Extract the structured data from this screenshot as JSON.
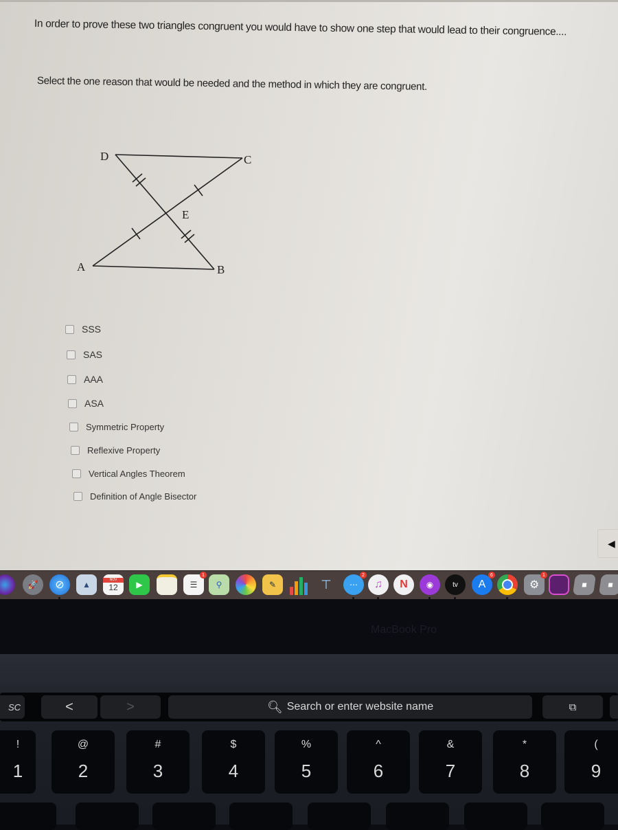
{
  "question": {
    "line1": "In order to prove these two triangles congruent you would have to show one step that would lead to their congruence....",
    "line2": "Select the one reason that would be needed and the method in which they are congruent."
  },
  "figure": {
    "labels": {
      "D": "D",
      "C": "C",
      "E": "E",
      "A": "A",
      "B": "B"
    }
  },
  "options": [
    {
      "label": "SSS",
      "checked": false
    },
    {
      "label": "SAS",
      "checked": false
    },
    {
      "label": "AAA",
      "checked": false
    },
    {
      "label": "ASA",
      "checked": false
    },
    {
      "label": "Symmetric Property",
      "checked": false
    },
    {
      "label": "Reflexive Property",
      "checked": false
    },
    {
      "label": "Vertical Angles Theorem",
      "checked": false
    },
    {
      "label": "Definition of Angle Bisector",
      "checked": false
    }
  ],
  "back_button": {
    "icon": "left-triangle-icon",
    "glyph": "◀"
  },
  "dock": {
    "calendar_month": "NOV",
    "calendar_day": "12",
    "reminders_badge": "1",
    "messages_badge": "2",
    "appstore_badge": "6",
    "preferences_badge": "1",
    "appletv_label": "tv"
  },
  "bezel_label": "MacBook Pro",
  "touchbar": {
    "esc": "SC",
    "back": "<",
    "forward": ">",
    "search_placeholder": "Search or enter website name"
  },
  "keys": [
    {
      "sym": "!",
      "num": "1"
    },
    {
      "sym": "@",
      "num": "2"
    },
    {
      "sym": "#",
      "num": "3"
    },
    {
      "sym": "$",
      "num": "4"
    },
    {
      "sym": "%",
      "num": "5"
    },
    {
      "sym": "^",
      "num": "6"
    },
    {
      "sym": "&",
      "num": "7"
    },
    {
      "sym": "*",
      "num": "8"
    },
    {
      "sym": "(",
      "num": "9"
    }
  ]
}
